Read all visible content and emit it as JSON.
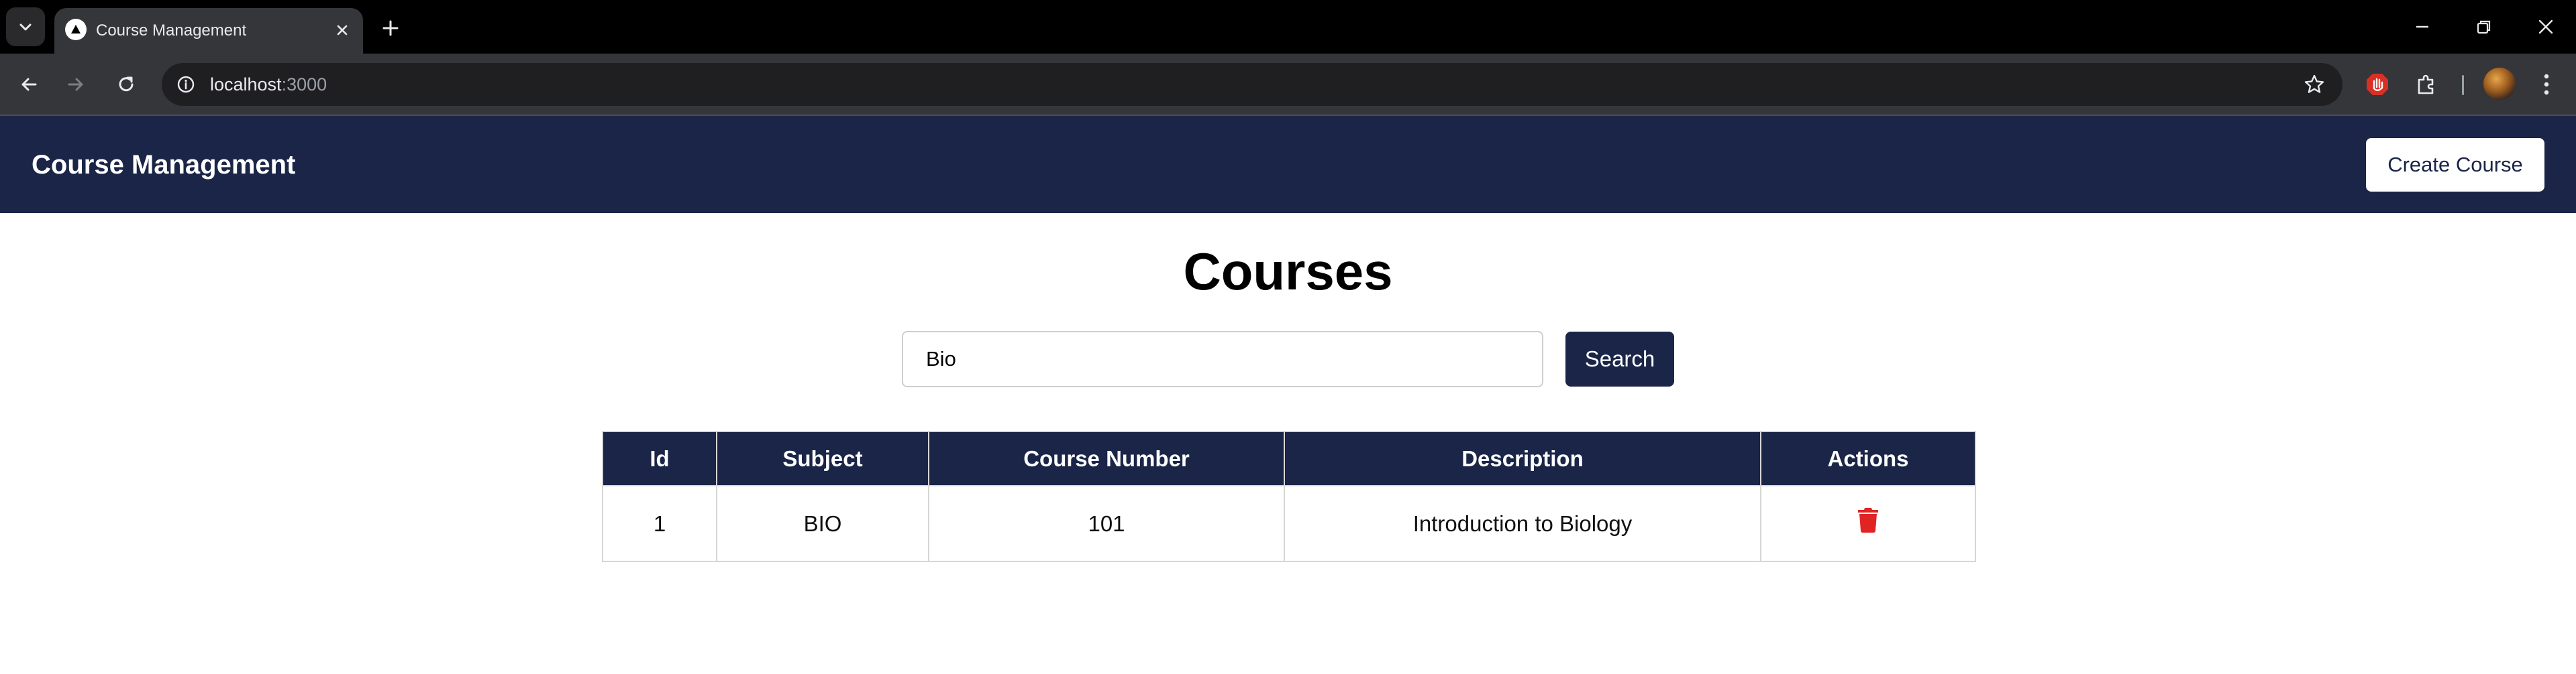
{
  "browser": {
    "tab_title": "Course Management",
    "url_host": "localhost",
    "url_port": ":3000"
  },
  "header": {
    "brand": "Course Management",
    "create_label": "Create Course"
  },
  "main": {
    "title": "Courses",
    "search_value": "Bio",
    "search_label": "Search"
  },
  "table": {
    "columns": [
      "Id",
      "Subject",
      "Course Number",
      "Description",
      "Actions"
    ],
    "rows": [
      {
        "id": "1",
        "subject": "BIO",
        "course_number": "101",
        "description": "Introduction to Biology",
        "action_icon": "trash-icon"
      }
    ]
  },
  "colors": {
    "navy": "#1a2547",
    "delete_red": "#e02424"
  }
}
